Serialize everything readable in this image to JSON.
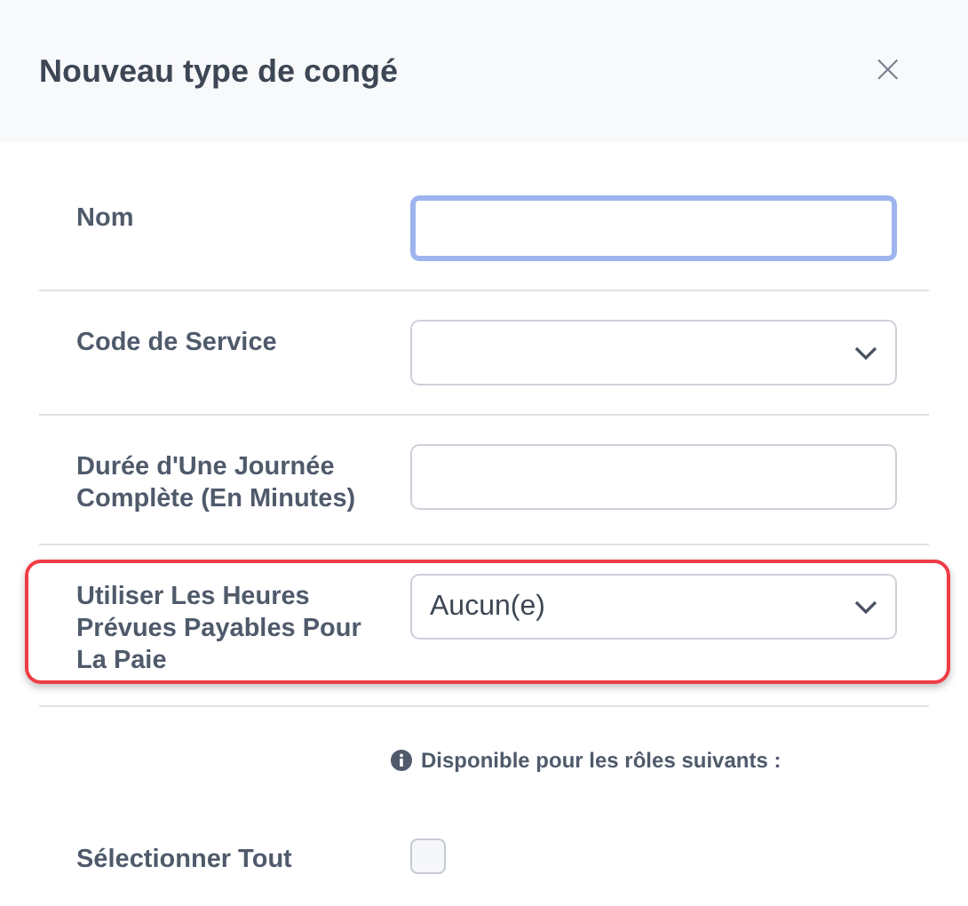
{
  "dialog": {
    "title": "Nouveau type de congé",
    "close": "×"
  },
  "fields": [
    {
      "label": "Nom",
      "kind": "text",
      "focused": true,
      "highlighted": false
    },
    {
      "label": "Code de Service",
      "kind": "select",
      "highlighted": false
    },
    {
      "label": "Durée d'Une Journée Complète (En Minutes)",
      "kind": "text",
      "focused": false,
      "highlighted": false
    },
    {
      "label": "Utiliser Les Heures Prévues Payables Pour La Paie",
      "kind": "select",
      "value": "Aucun(e)",
      "highlighted": true
    }
  ],
  "roles_note": "Disponible pour les rôles suivants :",
  "select_all": {
    "label": "Sélectionner Tout",
    "checked": false
  }
}
